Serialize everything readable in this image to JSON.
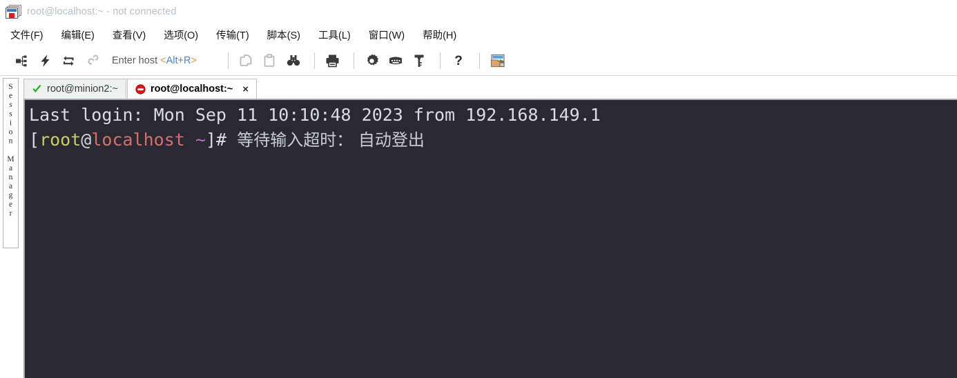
{
  "window": {
    "title": "root@localhost:~ - not connected",
    "icon": "securecrt-app-icon"
  },
  "menubar": {
    "items": [
      {
        "label": "文件(F)",
        "name": "menu-file"
      },
      {
        "label": "编辑(E)",
        "name": "menu-edit"
      },
      {
        "label": "查看(V)",
        "name": "menu-view"
      },
      {
        "label": "选项(O)",
        "name": "menu-options"
      },
      {
        "label": "传输(T)",
        "name": "menu-transfer"
      },
      {
        "label": "脚本(S)",
        "name": "menu-script"
      },
      {
        "label": "工具(L)",
        "name": "menu-tools"
      },
      {
        "label": "窗口(W)",
        "name": "menu-window"
      },
      {
        "label": "帮助(H)",
        "name": "menu-help"
      }
    ]
  },
  "toolbar": {
    "host_field": {
      "prefix": "Enter host ",
      "shortcut_open": "<",
      "shortcut": "Alt+R",
      "shortcut_close": ">",
      "full_text": "Enter host <Alt+R>"
    },
    "icons": [
      {
        "name": "connect-session-icon",
        "title": "连接"
      },
      {
        "name": "quick-connect-lightning-icon",
        "title": "快速连接"
      },
      {
        "name": "reconnect-arrows-icon",
        "title": "重新连接"
      },
      {
        "name": "disconnect-broken-link-icon",
        "title": "断开连接"
      },
      {
        "name": "copy-icon",
        "title": "复制"
      },
      {
        "name": "paste-icon",
        "title": "粘贴"
      },
      {
        "name": "find-binoculars-icon",
        "title": "查找"
      },
      {
        "name": "print-icon",
        "title": "打印"
      },
      {
        "name": "gear-settings-icon",
        "title": "会话选项"
      },
      {
        "name": "keyboard-icon",
        "title": "键盘"
      },
      {
        "name": "key-icon",
        "title": "密钥"
      },
      {
        "name": "help-question-icon",
        "title": "帮助"
      },
      {
        "name": "secure-file-transfer-icon",
        "title": "文件传输"
      }
    ]
  },
  "sidebar": {
    "label": "Session Manager"
  },
  "tabs": [
    {
      "label": "root@minion2:~",
      "status": "connected",
      "icon": "green-check-icon",
      "active": false
    },
    {
      "label": "root@localhost:~",
      "status": "disconnected",
      "icon": "red-prohibited-icon",
      "active": true,
      "close_label": "×"
    }
  ],
  "terminal": {
    "background_color": "#2a2833",
    "line1": {
      "text": "Last login: Mon Sep 11 10:10:48 2023 from 192.168.149.1"
    },
    "line2": {
      "bracket_open": "[",
      "user": "root",
      "at": "@",
      "host": "localhost",
      "space": " ",
      "tilde": "~",
      "bracket_close": "]#",
      "message": "  等待输入超时： 自动登出"
    },
    "colors": {
      "user": "#c8cf5e",
      "host": "#d4706a",
      "tilde": "#c06cc9",
      "default_text": "#d9dce5"
    }
  }
}
